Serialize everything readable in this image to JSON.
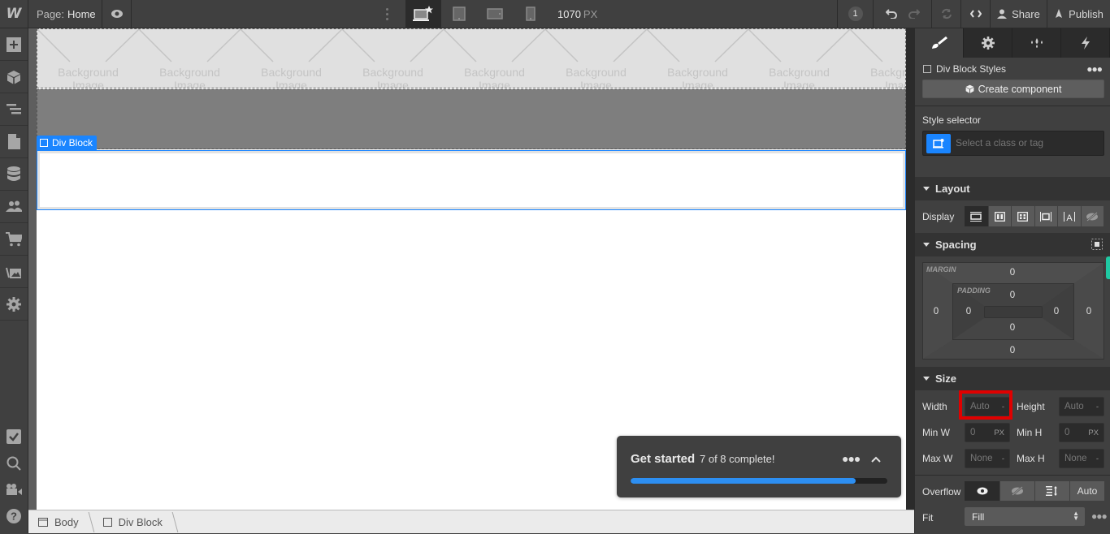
{
  "topbar": {
    "logo": "W",
    "page_prefix": "Page:",
    "page_name": "Home",
    "canvas_width_value": "1070",
    "canvas_width_unit": "PX",
    "notification_count": "1",
    "share_label": "Share",
    "publish_label": "Publish",
    "devices": [
      "desktop-base",
      "tablet",
      "mobile-landscape",
      "mobile-portrait"
    ]
  },
  "leftbar": {
    "items": [
      "add-panel",
      "components",
      "navigator",
      "pages",
      "cms",
      "users",
      "ecommerce",
      "assets",
      "settings"
    ],
    "bottom_items": [
      "audit",
      "search",
      "video-tutorials",
      "help"
    ]
  },
  "canvas": {
    "bg_image_text_line1": "Background",
    "bg_image_text_line2": "Image",
    "bg_image_tile_count": 9,
    "selected_element_label": "Div Block"
  },
  "get_started": {
    "title": "Get started",
    "status": "7 of 8 complete!",
    "completed": 7,
    "total": 8,
    "progress_fraction": 0.875
  },
  "breadcrumb": {
    "items": [
      {
        "label": "Body",
        "icon": "body-icon"
      },
      {
        "label": "Div Block",
        "icon": "div-block-icon"
      }
    ]
  },
  "panel": {
    "tabs": [
      "style",
      "settings",
      "interactions-styles",
      "interactions"
    ],
    "active_tab": "style",
    "selector_title": "Div Block Styles",
    "create_component_label": "Create component",
    "style_selector_label": "Style selector",
    "style_selector_placeholder": "Select a class or tag",
    "layout": {
      "heading": "Layout",
      "display_label": "Display",
      "display_options": [
        "block",
        "flex",
        "grid",
        "inline-block",
        "inline",
        "none"
      ],
      "display_active": "block"
    },
    "spacing": {
      "heading": "Spacing",
      "margin_label": "MARGIN",
      "padding_label": "PADDING",
      "margin": {
        "top": "0",
        "right": "0",
        "bottom": "0",
        "left": "0"
      },
      "padding": {
        "top": "0",
        "right": "0",
        "bottom": "0",
        "left": "0"
      }
    },
    "size": {
      "heading": "Size",
      "width_label": "Width",
      "width_value": "Auto",
      "width_unit": "-",
      "height_label": "Height",
      "height_value": "Auto",
      "height_unit": "-",
      "min_w_label": "Min W",
      "min_w_value": "0",
      "min_w_unit": "PX",
      "min_h_label": "Min H",
      "min_h_value": "0",
      "min_h_unit": "PX",
      "max_w_label": "Max W",
      "max_w_value": "None",
      "max_w_unit": "-",
      "max_h_label": "Max H",
      "max_h_value": "None",
      "max_h_unit": "-",
      "overflow_label": "Overflow",
      "overflow_options": [
        "visible",
        "hidden",
        "scroll",
        "Auto"
      ],
      "overflow_active": "visible",
      "fit_label": "Fit",
      "fit_value": "Fill"
    }
  },
  "colors": {
    "accent": "#1a85ff",
    "highlight": "#e00000",
    "progress": "#2d8ff2",
    "spacing_tab": "#1fc9a3"
  }
}
